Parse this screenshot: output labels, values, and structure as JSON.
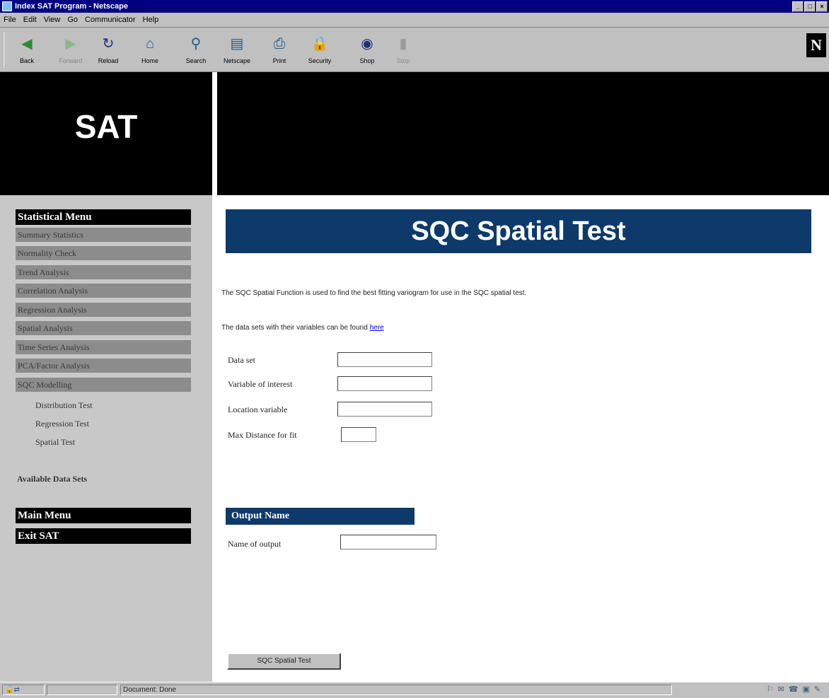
{
  "window": {
    "title": "Index SAT Program - Netscape",
    "controls": [
      "_",
      "□",
      "×"
    ]
  },
  "menubar": [
    "File",
    "Edit",
    "View",
    "Go",
    "Communicator",
    "Help"
  ],
  "toolbar": {
    "buttons": [
      {
        "label": "Back",
        "icon": "back-arrow-icon",
        "glyph": "◀",
        "color": "#2e8b2e"
      },
      {
        "label": "Forward",
        "icon": "forward-arrow-icon",
        "glyph": "▶",
        "color": "#8ab88a",
        "disabled": true
      },
      {
        "label": "Reload",
        "icon": "reload-icon",
        "glyph": "↻",
        "color": "#1c2f7a"
      },
      {
        "label": "Home",
        "icon": "home-icon",
        "glyph": "⌂",
        "color": "#1c5c8c"
      },
      {
        "label": "Search",
        "icon": "search-icon",
        "glyph": "⚲",
        "color": "#1c5c8c"
      },
      {
        "label": "Netscape",
        "icon": "netscape-icon",
        "glyph": "▤",
        "color": "#1c5c8c"
      },
      {
        "label": "Print",
        "icon": "print-icon",
        "glyph": "⎙",
        "color": "#1c5c8c"
      },
      {
        "label": "Security",
        "icon": "security-icon",
        "glyph": "🔒",
        "color": "#b0282a"
      },
      {
        "label": "Shop",
        "icon": "shop-icon",
        "glyph": "◉",
        "color": "#1c2f7a"
      },
      {
        "label": "Stop",
        "icon": "stop-icon",
        "glyph": "▮",
        "color": "#9a9a9a",
        "disabled": true
      }
    ],
    "logo": "N"
  },
  "banner": {
    "title": "SAT"
  },
  "sidebar": {
    "heading": "Statistical Menu",
    "items": [
      "Summary Statistics",
      "Normality Check",
      "Trend Analysis",
      "Correlation Analysis",
      "Regression Analysis",
      "Spatial Analysis",
      "Time Series Analysis",
      "PCA/Factor Analysis",
      "SQC Modelling"
    ],
    "subitems": [
      "Distribution Test",
      "Regression Test",
      "Spatial Test"
    ],
    "available": "Available Data Sets",
    "main_menu": "Main Menu",
    "exit": "Exit SAT"
  },
  "main": {
    "title": "SQC Spatial Test",
    "description": "The SQC Spatial Function is used to find the best fitting variogram for use in the SQC spatial test.",
    "datasets_prefix": "The data sets with their variables can be found ",
    "datasets_link": "here",
    "fields": [
      {
        "label": "Data set",
        "value": ""
      },
      {
        "label": "Variable of interest",
        "value": ""
      },
      {
        "label": "Location variable",
        "value": ""
      },
      {
        "label": "Max Distance for fit",
        "value": ""
      }
    ],
    "output_heading": "Output Name",
    "output_field": {
      "label": "Name of output",
      "value": ""
    },
    "submit_label": "SQC Spatial Test"
  },
  "status": {
    "text": "Document: Done"
  },
  "colors": {
    "title_bar": "#000080",
    "banner": "#000000",
    "heading_blue": "#0d3a6a",
    "menu_gray": "#8c8c8c",
    "sidebar_bg": "#c8c8c8"
  }
}
